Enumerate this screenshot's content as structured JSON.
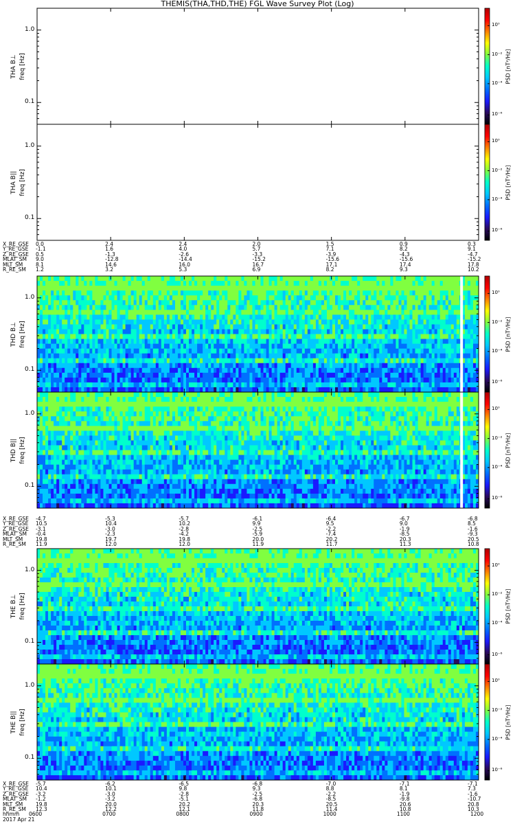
{
  "title": "THEMIS(THA,THD,THE) FGL Wave Survey Plot (Log)",
  "time_axis": {
    "row_label": "hhmm",
    "date_label": "2017 Apr 21",
    "ticks": [
      "0600",
      "0700",
      "0800",
      "0900",
      "1000",
      "1100",
      "1200"
    ]
  },
  "colorbar": {
    "label": "PSD [nT²/Hz]",
    "tick_labels": [
      "10⁰",
      "10⁻²",
      "10⁻⁴",
      "10⁻⁶"
    ],
    "colors": [
      "#000000",
      "#2a0a5e",
      "#1a1aff",
      "#0070ff",
      "#00c8ff",
      "#00ffcc",
      "#80ff40",
      "#ffff00",
      "#ff8000",
      "#ff0000",
      "#b00000"
    ]
  },
  "chart_data": [
    {
      "type": "heatmap",
      "probe": "THA",
      "component": "B⊥",
      "ylabel": "THA B⊥",
      "ylabel2": "freq [Hz]",
      "y_scale": "log",
      "ylim": [
        0.05,
        2.0
      ],
      "y_ticks": [
        "1.0",
        "0.1"
      ],
      "has_data": false
    },
    {
      "type": "heatmap",
      "probe": "THA",
      "component": "B||",
      "ylabel": "THA B||",
      "ylabel2": "freq [Hz]",
      "y_scale": "log",
      "ylim": [
        0.05,
        2.0
      ],
      "y_ticks": [
        "1.0",
        "0.1"
      ],
      "has_data": false
    },
    {
      "type": "heatmap",
      "probe": "THD",
      "component": "B⊥",
      "ylabel": "THD B⊥",
      "ylabel2": "freq [Hz]",
      "y_scale": "log",
      "ylim": [
        0.05,
        2.0
      ],
      "y_ticks": [
        "1.0",
        "0.1"
      ],
      "has_data": true,
      "data_gap_hhmm": "1145"
    },
    {
      "type": "heatmap",
      "probe": "THD",
      "component": "B||",
      "ylabel": "THD B||",
      "ylabel2": "freq [Hz]",
      "y_scale": "log",
      "ylim": [
        0.05,
        2.0
      ],
      "y_ticks": [
        "1.0",
        "0.1"
      ],
      "has_data": true,
      "data_gap_hhmm": "1145"
    },
    {
      "type": "heatmap",
      "probe": "THE",
      "component": "B⊥",
      "ylabel": "THE B⊥",
      "ylabel2": "freq [Hz]",
      "y_scale": "log",
      "ylim": [
        0.05,
        2.0
      ],
      "y_ticks": [
        "1.0",
        "0.1"
      ],
      "has_data": true
    },
    {
      "type": "heatmap",
      "probe": "THE",
      "component": "B||",
      "ylabel": "THE B||",
      "ylabel2": "freq [Hz]",
      "y_scale": "log",
      "ylim": [
        0.05,
        2.0
      ],
      "y_ticks": [
        "1.0",
        "0.1"
      ],
      "has_data": true
    }
  ],
  "ephemeris": [
    {
      "probe": "THA",
      "rows": [
        {
          "name": "X_RE_GSE",
          "values": [
            "0.0",
            "2.4",
            "2.4",
            "2.0",
            "1.5",
            "0.9",
            "0.3"
          ]
        },
        {
          "name": "Y_RE_GSE",
          "values": [
            "-1.1",
            "1.6",
            "4.0",
            "5.7",
            "7.1",
            "8.2",
            "9.1"
          ]
        },
        {
          "name": "Z_RE_GSE",
          "values": [
            "0.5",
            "-1.3",
            "-2.6",
            "-3.3",
            "-3.9",
            "-4.3",
            "-4.7"
          ]
        },
        {
          "name": "MLAT_SM",
          "values": [
            "9.0",
            "-12.8",
            "-14.4",
            "-15.2",
            "-15.6",
            "-15.6",
            "-15.2"
          ]
        },
        {
          "name": "MLT_SM",
          "values": [
            "8.1",
            "14.6",
            "16.0",
            "16.7",
            "17.1",
            "17.4",
            "17.8"
          ]
        },
        {
          "name": "R_RE_SM",
          "values": [
            "1.2",
            "3.2",
            "5.3",
            "6.9",
            "8.2",
            "9.3",
            "10.2"
          ]
        }
      ]
    },
    {
      "probe": "THD",
      "rows": [
        {
          "name": "X_RE_GSE",
          "values": [
            "-4.7",
            "-5.3",
            "-5.7",
            "-6.1",
            "-6.4",
            "-6.7",
            "-6.8"
          ]
        },
        {
          "name": "Y_RE_GSE",
          "values": [
            "10.5",
            "10.4",
            "10.2",
            "9.9",
            "9.5",
            "9.0",
            "8.5"
          ]
        },
        {
          "name": "Z_RE_GSE",
          "values": [
            "-3.1",
            "-3.0",
            "-2.8",
            "-2.5",
            "-2.2",
            "-1.9",
            "-1.6"
          ]
        },
        {
          "name": "MLAT_SM",
          "values": [
            "-0.4",
            "-2.3",
            "-4.2",
            "-5.9",
            "-7.4",
            "-8.5",
            "-9.3"
          ]
        },
        {
          "name": "MLT_SM",
          "values": [
            "19.8",
            "19.7",
            "19.8",
            "20.0",
            "20.2",
            "20.3",
            "20.5"
          ]
        },
        {
          "name": "R_RE_SM",
          "values": [
            "11.9",
            "12.0",
            "12.0",
            "11.9",
            "11.7",
            "11.3",
            "10.8"
          ]
        }
      ]
    },
    {
      "probe": "THE",
      "rows": [
        {
          "name": "X_RE_GSE",
          "values": [
            "-5.7",
            "-6.2",
            "-6.5",
            "-6.8",
            "-7.0",
            "-7.1",
            "-7.1"
          ]
        },
        {
          "name": "Y_RE_GSE",
          "values": [
            "10.4",
            "10.1",
            "9.8",
            "9.3",
            "8.8",
            "8.1",
            "7.3"
          ]
        },
        {
          "name": "Z_RE_GSE",
          "values": [
            "-3.2",
            "-3.0",
            "-2.8",
            "-2.5",
            "-2.2",
            "-1.9",
            "-1.6"
          ]
        },
        {
          "name": "MLAT_SM",
          "values": [
            "-1.2",
            "-3.2",
            "-5.1",
            "-6.8",
            "-8.5",
            "-9.8",
            "-10.7"
          ]
        },
        {
          "name": "MLT_SM",
          "values": [
            "19.8",
            "20.0",
            "20.2",
            "20.3",
            "20.5",
            "20.6",
            "20.8"
          ]
        },
        {
          "name": "R_RE_SM",
          "values": [
            "12.3",
            "12.2",
            "12.1",
            "11.8",
            "11.4",
            "10.8",
            "10.3"
          ]
        }
      ]
    }
  ]
}
